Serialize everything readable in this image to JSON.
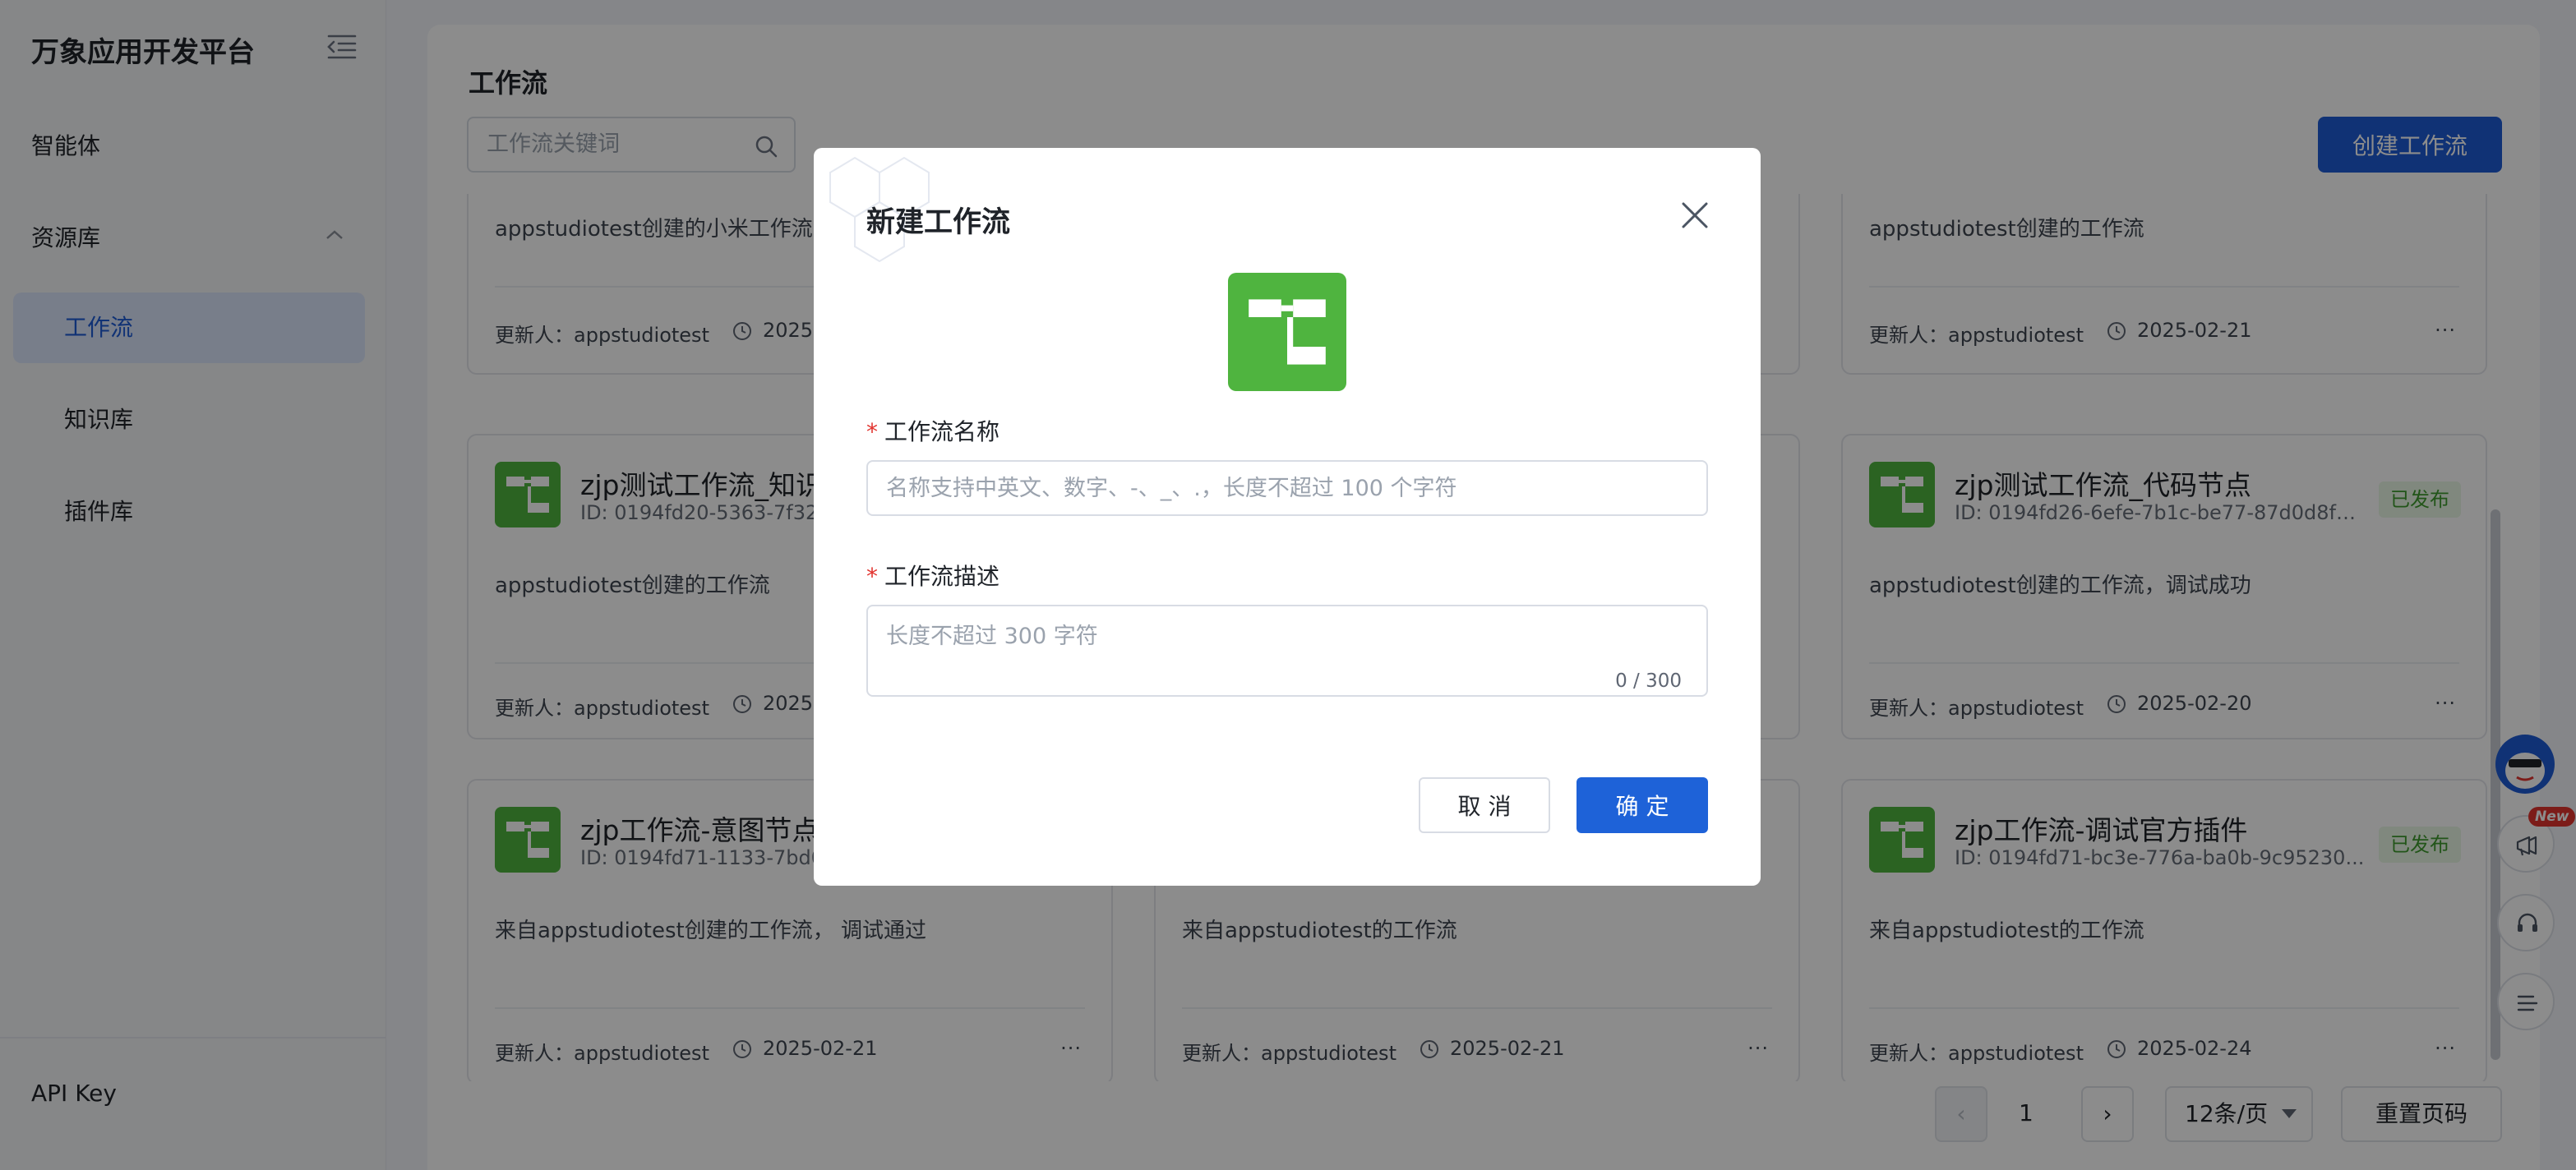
{
  "sidebar": {
    "brand": "万象应用开发平台",
    "items": [
      {
        "label": "智能体"
      },
      {
        "label": "资源库"
      },
      {
        "label": "工作流"
      },
      {
        "label": "知识库"
      },
      {
        "label": "插件库"
      }
    ],
    "api_key": "API Key"
  },
  "main": {
    "title": "工作流",
    "search_placeholder": "工作流关键词",
    "create_label": "创建工作流"
  },
  "cards": [
    {
      "title": "",
      "id": "",
      "badge": "",
      "desc": "appstudiotest创建的小米工作流,",
      "user": "更新人：appstudiotest",
      "date": "2025-"
    },
    {
      "title": "",
      "id": "",
      "badge": "",
      "desc": "appstudiotest创建的工作流",
      "user": "更新人：appstudiotest",
      "date": "2025-02-21"
    },
    {
      "title": "zjp测试工作流_知识",
      "id": "ID: 0194fd20-5363-7f32-",
      "badge": "",
      "desc": "appstudiotest创建的工作流",
      "user": "更新人：appstudiotest",
      "date": "2025-"
    },
    {
      "title": "zjp测试工作流_代码节点",
      "id": "ID: 0194fd26-6efe-7b1c-be77-87d0d8f9...",
      "badge": "已发布",
      "desc": "appstudiotest创建的工作流，调试成功",
      "user": "更新人：appstudiotest",
      "date": "2025-02-20"
    },
    {
      "title": "zjp工作流-意图节点",
      "id": "ID: 0194fd71-1133-7bd0-",
      "badge": "",
      "desc": "来自appstudiotest创建的工作流， 调试通过",
      "user": "更新人：appstudiotest",
      "date": "2025-02-21"
    },
    {
      "title": "",
      "id": "",
      "badge": "",
      "desc": "来自appstudiotest的工作流",
      "user": "更新人：appstudiotest",
      "date": "2025-02-21"
    },
    {
      "title": "zjp工作流-调试官方插件",
      "id": "ID: 0194fd71-bc3e-776a-ba0b-9c95230...",
      "badge": "已发布",
      "desc": "来自appstudiotest的工作流",
      "user": "更新人：appstudiotest",
      "date": "2025-02-24"
    }
  ],
  "more_glyph": "···",
  "pagination": {
    "prev": "‹",
    "page": "1",
    "next": "›",
    "page_size": "12条/页",
    "reset": "重置页码"
  },
  "floating": {
    "new_tag": "New"
  },
  "modal": {
    "title": "新建工作流",
    "name_label": "工作流名称",
    "name_placeholder": "名称支持中英文、数字、-、_、.，长度不超过 100 个字符",
    "desc_label": "工作流描述",
    "desc_placeholder": "长度不超过 300 字符",
    "counter": "0 / 300",
    "required_mark": "*",
    "cancel": "取 消",
    "confirm": "确 定"
  },
  "colors": {
    "primary": "#1e5bd6",
    "workflow_green": "#4fb43f",
    "published_bg": "#e9f7e5",
    "published_text": "#3f9b2e",
    "required_red": "#e2342f"
  },
  "icons": [
    "collapse-menu-icon",
    "chevron-up-icon",
    "search-icon",
    "workflow-icon",
    "clock-icon",
    "more-icon",
    "close-icon",
    "assistant-mascot-icon",
    "megaphone-icon",
    "headset-icon",
    "list-icon"
  ]
}
